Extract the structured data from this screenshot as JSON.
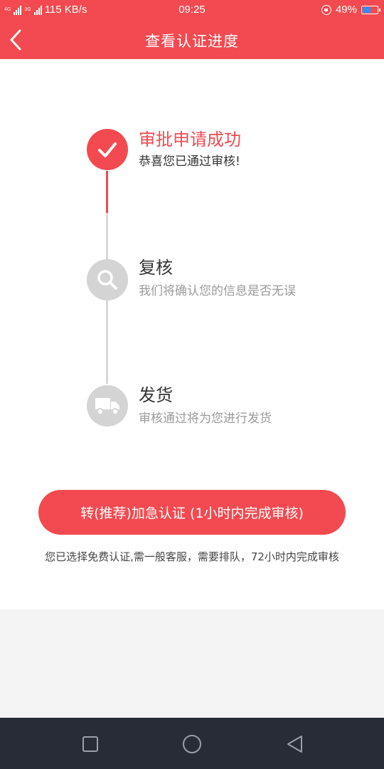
{
  "status_bar": {
    "network_tag_1": "4G",
    "network_tag_2": "3G",
    "speed": "115 KB/s",
    "time": "09:25",
    "battery": "49%"
  },
  "header": {
    "title": "查看认证进度"
  },
  "steps": [
    {
      "title": "审批申请成功",
      "desc": "恭喜您已通过审核!",
      "status": "done",
      "icon": "check-icon"
    },
    {
      "title": "复核",
      "desc": "我们将确认您的信息是否无误",
      "status": "pending",
      "icon": "search-icon"
    },
    {
      "title": "发货",
      "desc": "审核通过将为您进行发货",
      "status": "pending",
      "icon": "truck-icon"
    }
  ],
  "urgent_button": {
    "label": "转(推荐)加急认证 (1小时内完成审核)"
  },
  "note": "您已选择免费认证,需一般客服，需要排队，72小时内完成审核",
  "colors": {
    "accent": "#f24a50",
    "pending": "#d4d4d4",
    "nav_bg": "#282c36"
  }
}
